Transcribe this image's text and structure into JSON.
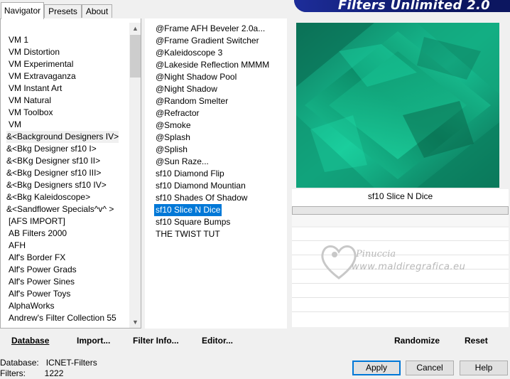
{
  "app": {
    "title": "Filters Unlimited 2.0"
  },
  "tabs": [
    {
      "label": "Navigator"
    },
    {
      "label": "Presets"
    },
    {
      "label": "About"
    }
  ],
  "categories": [
    "VM 1",
    "VM Distortion",
    "VM Experimental",
    "VM Extravaganza",
    "VM Instant Art",
    "VM Natural",
    "VM Toolbox",
    "VM",
    "&<Background Designers IV>",
    "&<Bkg Designer sf10 I>",
    "&<BKg Designer sf10 II>",
    "&<Bkg Designer sf10 III>",
    "&<Bkg Designers sf10 IV>",
    "&<Bkg Kaleidoscope>",
    "&<Sandflower Specials^v^ >",
    "[AFS IMPORT]",
    "AB Filters 2000",
    "AFH",
    "Alf's Border FX",
    "Alf's Power Grads",
    "Alf's Power Sines",
    "Alf's Power Toys",
    "AlphaWorks",
    "Andrew's Filter Collection 55"
  ],
  "category_selected_index": 8,
  "filters": [
    "@Frame AFH Beveler 2.0a...",
    "@Frame Gradient Switcher",
    "@Kaleidoscope 3",
    "@Lakeside Reflection MMMM",
    "@Night Shadow Pool",
    "@Night Shadow",
    "@Random Smelter",
    "@Refractor",
    "@Smoke",
    "@Splash",
    "@Splish",
    "@Sun Raze...",
    "sf10 Diamond Flip",
    "sf10 Diamond Mountian",
    "sf10 Shades Of Shadow",
    "sf10 Slice N Dice",
    "sf10 Square Bumps",
    "THE TWIST TUT"
  ],
  "filter_selected_index": 15,
  "preview": {
    "filter_name": "sf10 Slice N Dice",
    "watermark_line1": "Pinuccia",
    "watermark_line2": "www.maldiregrafica.eu"
  },
  "buttons": {
    "database": "Database",
    "import": "Import...",
    "filter_info": "Filter Info...",
    "editor": "Editor...",
    "randomize": "Randomize",
    "reset": "Reset",
    "apply": "Apply",
    "cancel": "Cancel",
    "help": "Help"
  },
  "status": {
    "database_label": "Database:",
    "database_value": "ICNET-Filters",
    "filters_label": "Filters:",
    "filters_value": "1222"
  },
  "colors": {
    "selection": "#0078d7",
    "banner": "#0f1c6e",
    "preview_teal": "#12b88e"
  }
}
